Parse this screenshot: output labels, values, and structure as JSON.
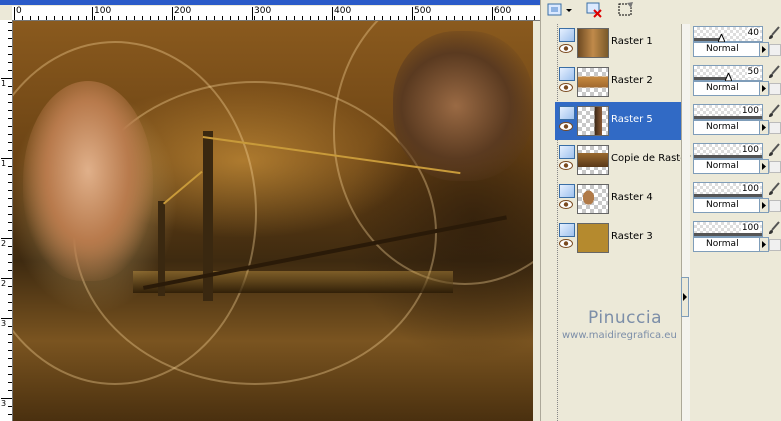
{
  "ruler": {
    "h_labels": [
      "0",
      "100",
      "200",
      "300",
      "400",
      "500",
      "600"
    ],
    "v_labels": [
      "1",
      "1",
      "2",
      "2",
      "3",
      "3"
    ]
  },
  "toolbar": {
    "icons": [
      "new-layer-icon",
      "delete-layer-icon",
      "mask-icon"
    ]
  },
  "layers": [
    {
      "name": "Raster 1",
      "thumb_color": "#8a5a2a",
      "opacity": "40",
      "blend": "Normal",
      "selected": false
    },
    {
      "name": "Raster 2",
      "thumb_color": "#a0682e",
      "opacity": "50",
      "blend": "Normal",
      "selected": false
    },
    {
      "name": "Raster 5",
      "thumb_color": "#5a3a20",
      "opacity": "100",
      "blend": "Normal",
      "selected": true
    },
    {
      "name": "Copie de Raster",
      "thumb_color": "#9a6a30",
      "opacity": "100",
      "blend": "Normal",
      "selected": false
    },
    {
      "name": "Raster 4",
      "thumb_color": "#b07a48",
      "opacity": "100",
      "blend": "Normal",
      "selected": false
    },
    {
      "name": "Raster 3",
      "thumb_color": "#b58a2e",
      "opacity": "100",
      "blend": "Normal",
      "selected": false
    }
  ],
  "watermark": {
    "title": "Pinuccia",
    "url": "www.maidiregrafica.eu"
  },
  "colors": {
    "selection": "#316ac5",
    "panel_bg": "#ece9d8",
    "watermark": "#7c8ea8"
  }
}
